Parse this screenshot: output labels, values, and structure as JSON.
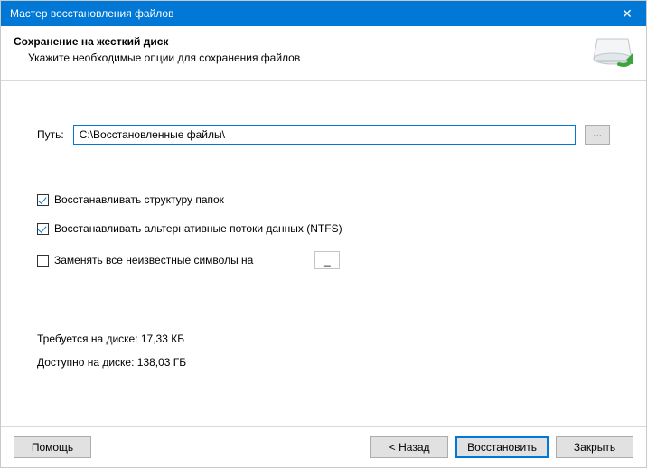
{
  "title": "Мастер восстановления файлов",
  "header": {
    "title": "Сохранение на жесткий диск",
    "subtitle": "Укажите необходимые опции для сохранения файлов"
  },
  "path": {
    "label": "Путь:",
    "value": "C:\\Восстановленные файлы\\",
    "browse": "..."
  },
  "options": {
    "restore_folders": {
      "label": "Восстанавливать структуру папок",
      "checked": true
    },
    "restore_ads": {
      "label": "Восстанавливать альтернативные потоки данных (NTFS)",
      "checked": true
    },
    "replace_unknown": {
      "label": "Заменять все неизвестные символы на",
      "checked": false,
      "value": "_"
    }
  },
  "disk": {
    "required": "Требуется на диске: 17,33 КБ",
    "available": "Доступно на диске: 138,03 ГБ"
  },
  "buttons": {
    "help": "Помощь",
    "back": "< Назад",
    "recover": "Восстановить",
    "close": "Закрыть"
  }
}
